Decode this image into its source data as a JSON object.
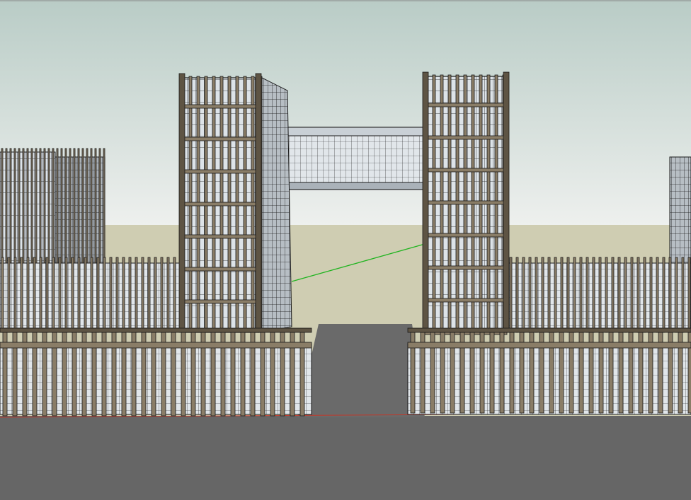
{
  "viewport": {
    "kind": "3d-model-viewport",
    "style": "wireframe-with-shaded-faces",
    "colors": {
      "sky_top": "#b9ccc6",
      "sky_bottom": "#eef0ee",
      "horizon_ground": "#cfcdb2",
      "ground": "#666666",
      "road": "#6a6a6a",
      "frame_wood": "#8a7d67",
      "frame_wood_dark": "#5e5444",
      "glass": "#dde3e8",
      "glass_dark": "#b3bcc4",
      "edge": "#1a1a1a",
      "red_axis": "#c0392b",
      "green_axis": "#1fb41f"
    }
  },
  "scene": {
    "objects": [
      "left-tower",
      "right-tower",
      "skybridge",
      "left-wing-building",
      "right-wing-building",
      "left-front-fence",
      "right-front-fence",
      "far-left-block",
      "far-right-block",
      "entrance-road"
    ]
  }
}
